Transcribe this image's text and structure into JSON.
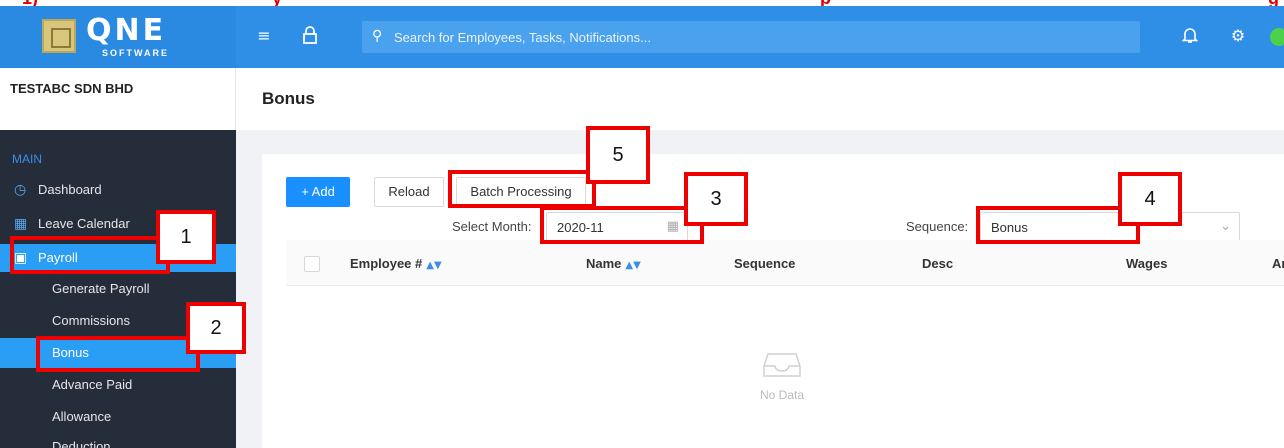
{
  "caption_fragment": [
    {
      "text": "1)",
      "color": "#e00000"
    },
    {
      "text": "y",
      "color": "#e00000"
    },
    {
      "text": "p",
      "color": "#e00000"
    },
    {
      "text": "g",
      "color": "#e00000"
    }
  ],
  "header": {
    "logo_text": "QNE",
    "logo_sub": "SOFTWARE",
    "search_placeholder": "Search for Employees, Tasks, Notifications...",
    "icons": [
      "menu-fold-icon",
      "lock-icon",
      "search-icon",
      "bell-icon",
      "gear-icon",
      "avatar"
    ],
    "colors": {
      "header_bg": "#2f8fe6",
      "accent": "#1890ff",
      "sidebar_bg": "#252c3a",
      "active_bg": "#2a9df4"
    }
  },
  "sidebar": {
    "company": "TESTABC SDN BHD",
    "section": "MAIN",
    "items": [
      {
        "label": "Dashboard",
        "icon": "dashboard-icon"
      },
      {
        "label": "Leave Calendar",
        "icon": "calendar-icon"
      },
      {
        "label": "Payroll",
        "icon": "wallet-icon",
        "active": true
      }
    ],
    "sub_items": [
      {
        "label": "Generate Payroll"
      },
      {
        "label": "Commissions"
      },
      {
        "label": "Bonus",
        "active": true
      },
      {
        "label": "Advance Paid"
      },
      {
        "label": "Allowance"
      },
      {
        "label": "Deduction"
      }
    ]
  },
  "main": {
    "page_title": "Bonus",
    "toolbar": {
      "add_label": "+ Add",
      "reload_label": "Reload",
      "batch_label": "Batch Processing"
    },
    "filters": {
      "month_label": "Select Month:",
      "month_value": "2020-11",
      "sequence_label": "Sequence:",
      "sequence_value": "Bonus"
    },
    "table": {
      "columns": [
        "Employee #",
        "Name",
        "Sequence",
        "Desc",
        "Wages",
        "Am"
      ],
      "sortable": [
        true,
        true,
        false,
        false,
        false,
        false
      ],
      "empty_text": "No Data"
    }
  },
  "annotations": [
    "1",
    "2",
    "3",
    "4",
    "5"
  ]
}
